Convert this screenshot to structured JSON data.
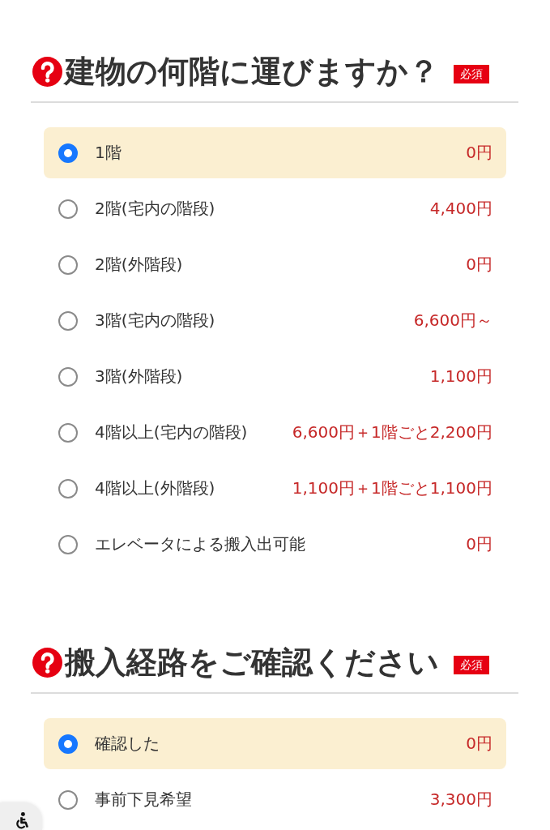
{
  "sections": [
    {
      "title": "建物の何階に運びますか？",
      "badge": "必須",
      "options": [
        {
          "label": "1階",
          "price": "0円",
          "selected": true
        },
        {
          "label": "2階(宅内の階段)",
          "price": "4,400円",
          "selected": false
        },
        {
          "label": "2階(外階段)",
          "price": "0円",
          "selected": false
        },
        {
          "label": "3階(宅内の階段)",
          "price": "6,600円～",
          "selected": false
        },
        {
          "label": "3階(外階段)",
          "price": "1,100円",
          "selected": false
        },
        {
          "label": "4階以上(宅内の階段)",
          "price": "6,600円＋1階ごと2,200円",
          "selected": false
        },
        {
          "label": "4階以上(外階段)",
          "price": "1,100円＋1階ごと1,100円",
          "selected": false
        },
        {
          "label": "エレベータによる搬入出可能",
          "price": "0円",
          "selected": false
        }
      ]
    },
    {
      "title": "搬入経路をご確認ください",
      "badge": "必須",
      "options": [
        {
          "label": "確認した",
          "price": "0円",
          "selected": true
        },
        {
          "label": "事前下見希望",
          "price": "3,300円",
          "selected": false
        }
      ]
    }
  ]
}
